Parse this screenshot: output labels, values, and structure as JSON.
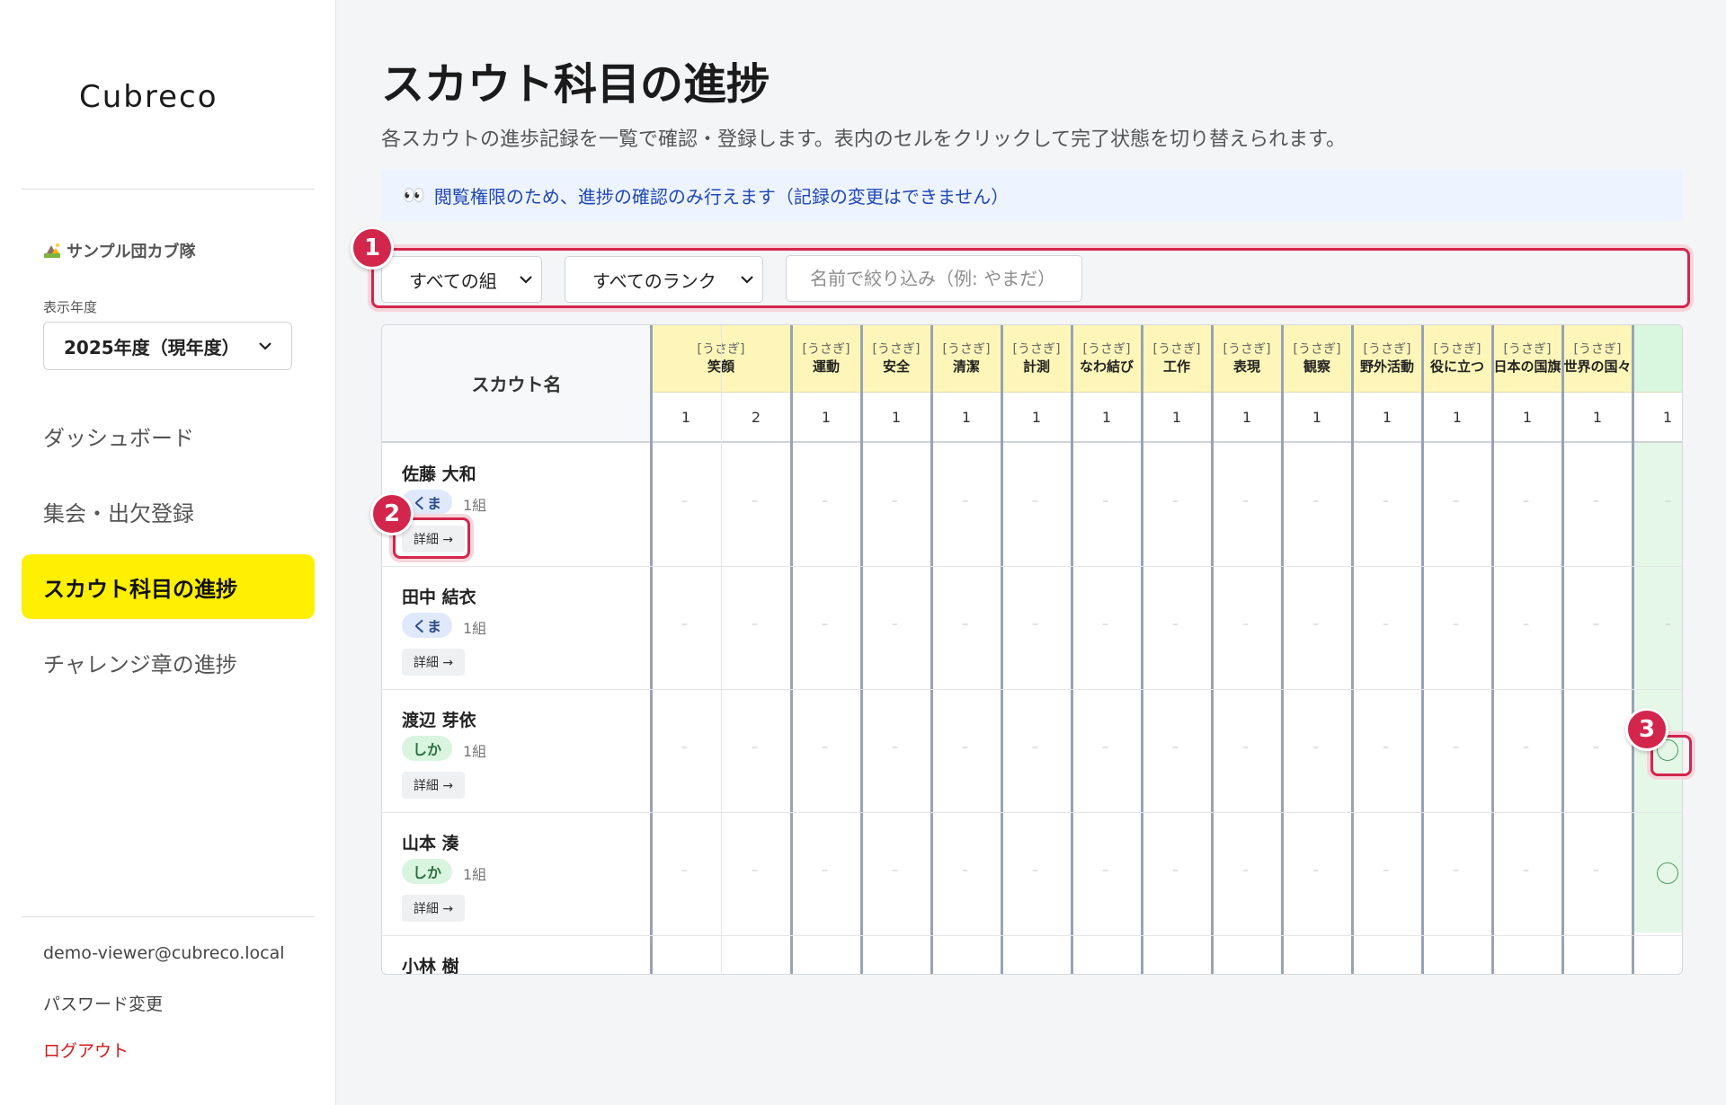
{
  "app": {
    "logo": "Cubreco"
  },
  "sidebar": {
    "org": "サンプル団カブ隊",
    "year_label": "表示年度",
    "year_value": "2025年度（現年度）",
    "nav": [
      {
        "label": "ダッシュボード",
        "active": false
      },
      {
        "label": "集会・出欠登録",
        "active": false
      },
      {
        "label": "スカウト科目の進捗",
        "active": true
      },
      {
        "label": "チャレンジ章の進捗",
        "active": false
      }
    ],
    "email": "demo-viewer@cubreco.local",
    "password_change": "パスワード変更",
    "logout": "ログアウト"
  },
  "page": {
    "title": "スカウト科目の進捗",
    "description": "各スカウトの進歩記録を一覧で確認・登録します。表内のセルをクリックして完了状態を切り替えられます。",
    "notice_icon": "👀",
    "notice": "閲覧権限のため、進捗の確認のみ行えます（記録の変更はできません）"
  },
  "filters": {
    "group": "すべての組",
    "rank": "すべてのランク",
    "name_placeholder": "名前で絞り込み（例: やまだ）"
  },
  "badges": [
    "1",
    "2",
    "3"
  ],
  "table": {
    "scout_header": "スカウト名",
    "columns": [
      {
        "cat": "[うさぎ]",
        "name": "笑顔",
        "nums": [
          "1",
          "2"
        ]
      },
      {
        "cat": "[うさぎ]",
        "name": "運動",
        "nums": [
          "1"
        ]
      },
      {
        "cat": "[うさぎ]",
        "name": "安全",
        "nums": [
          "1"
        ]
      },
      {
        "cat": "[うさぎ]",
        "name": "清潔",
        "nums": [
          "1"
        ]
      },
      {
        "cat": "[うさぎ]",
        "name": "計測",
        "nums": [
          "1"
        ]
      },
      {
        "cat": "[うさぎ]",
        "name": "なわ結び",
        "nums": [
          "1"
        ]
      },
      {
        "cat": "[うさぎ]",
        "name": "工作",
        "nums": [
          "1"
        ]
      },
      {
        "cat": "[うさぎ]",
        "name": "表現",
        "nums": [
          "1"
        ]
      },
      {
        "cat": "[うさぎ]",
        "name": "観察",
        "nums": [
          "1"
        ]
      },
      {
        "cat": "[うさぎ]",
        "name": "野外活動",
        "nums": [
          "1"
        ]
      },
      {
        "cat": "[うさぎ]",
        "name": "役に立つ",
        "nums": [
          "1"
        ]
      },
      {
        "cat": "[うさぎ]",
        "name": "日本の国旗",
        "nums": [
          "1"
        ]
      },
      {
        "cat": "[うさぎ]",
        "name": "世界の国々",
        "nums": [
          "1"
        ]
      },
      {
        "cat": "",
        "name": "",
        "nums": [
          "1"
        ]
      }
    ],
    "dash": "–",
    "detail_label": "詳細 →",
    "rows": [
      {
        "name": "佐藤 大和",
        "rank": "くま",
        "group": "1組",
        "last_done": false
      },
      {
        "name": "田中 結衣",
        "rank": "くま",
        "group": "1組",
        "last_done": false
      },
      {
        "name": "渡辺 芽依",
        "rank": "しか",
        "group": "1組",
        "last_done": true
      },
      {
        "name": "山本 湊",
        "rank": "しか",
        "group": "1組",
        "last_done": true
      },
      {
        "name": "小林 樹",
        "rank": "",
        "group": "",
        "last_done": false
      }
    ]
  }
}
